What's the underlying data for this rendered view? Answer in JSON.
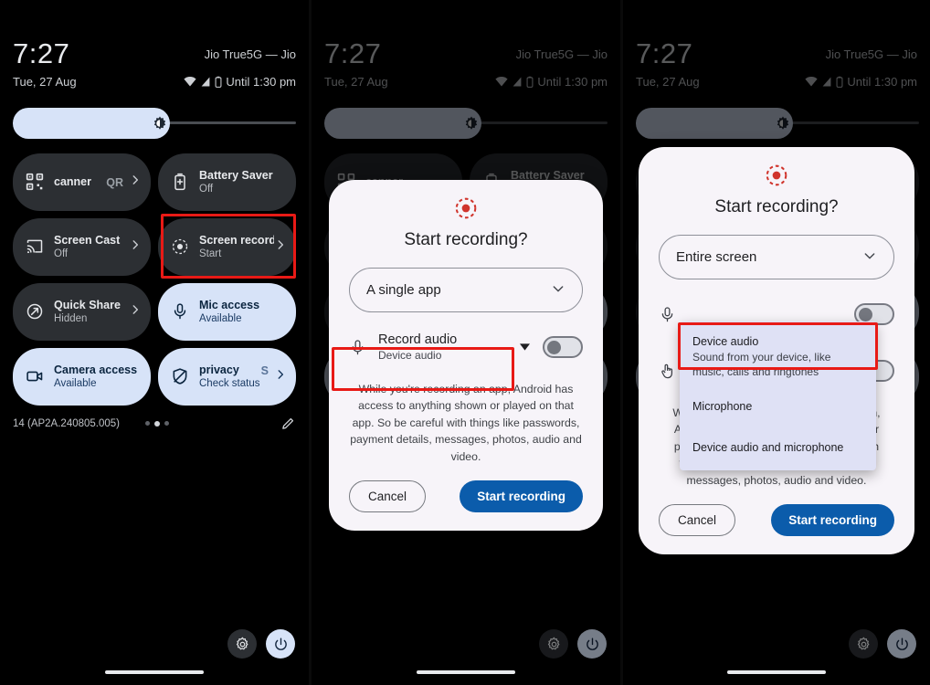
{
  "statusbar": {
    "time": "7:27",
    "date": "Tue, 27 Aug",
    "carrier": "Jio True5G — Jio",
    "battery_status": "Until 1:30 pm"
  },
  "quick_settings": {
    "tiles": [
      {
        "label": "canner",
        "sub": "",
        "ghost": "QR",
        "icon": "qr-scanner-icon",
        "state": "off",
        "chevron": true
      },
      {
        "label": "Battery Saver",
        "sub": "Off",
        "ghost": "",
        "icon": "battery-saver-icon",
        "state": "off",
        "chevron": false
      },
      {
        "label": "Screen Cast",
        "sub": "Off",
        "ghost": "",
        "icon": "screen-cast-icon",
        "state": "off",
        "chevron": true
      },
      {
        "label": "Screen record",
        "sub": "Start",
        "ghost": "",
        "icon": "screen-record-icon",
        "state": "off",
        "chevron": true
      },
      {
        "label": "Quick Share",
        "sub": "Hidden",
        "ghost": "",
        "icon": "quick-share-icon",
        "state": "off",
        "chevron": true
      },
      {
        "label": "Mic access",
        "sub": "Available",
        "ghost": "",
        "icon": "microphone-icon",
        "state": "on",
        "chevron": false
      },
      {
        "label": "Camera access",
        "sub": "Available",
        "ghost": "",
        "icon": "camera-icon",
        "state": "on",
        "chevron": false
      },
      {
        "label": "privacy",
        "sub": "Check status",
        "ghost": "S",
        "icon": "shield-icon",
        "state": "on",
        "chevron": true
      }
    ],
    "build": "14 (AP2A.240805.005)",
    "page_dots": 3,
    "active_dot": 1,
    "edit_icon": "pencil-icon",
    "settings_icon": "gear-icon",
    "power_icon": "power-icon"
  },
  "dialog2": {
    "icon": "screen-record-icon",
    "title": "Start recording?",
    "scope_value": "A single app",
    "audio_label": "Record audio",
    "audio_value": "Device audio",
    "audio_toggle": "off",
    "disclaimer": "While you're recording an app, Android has access to anything shown or played on that app. So be careful with things like passwords, payment details, messages, photos, audio and video.",
    "cancel_label": "Cancel",
    "start_label": "Start recording"
  },
  "dialog3": {
    "icon": "screen-record-icon",
    "title": "Start recording?",
    "scope_value": "Entire screen",
    "disclaimer": "While you're recording your entire screen, Android has access to anything shown or played on your device. So be careful with things like passwords, payment details, messages, photos, audio and video.",
    "cancel_label": "Cancel",
    "start_label": "Start recording",
    "dropdown": {
      "options": [
        {
          "title": "Device audio",
          "desc": "Sound from your device, like music, calls and ringtones",
          "selected": true
        },
        {
          "title": "Microphone",
          "desc": "",
          "selected": false
        },
        {
          "title": "Device audio and microphone",
          "desc": "",
          "selected": false
        }
      ]
    }
  },
  "colors": {
    "accent_blue": "#0b5cab",
    "tile_on": "#d7e3f8",
    "tile_off": "#2c2f33",
    "record_red": "#d0342c",
    "highlight_red": "#e81a16",
    "dialog_bg": "#f7f4f9",
    "dropdown_bg": "#dfe1f5"
  }
}
